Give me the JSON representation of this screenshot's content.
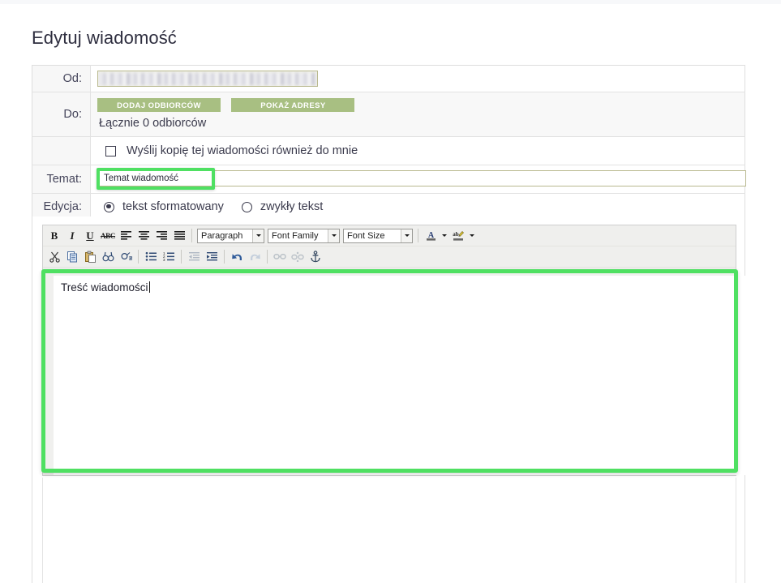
{
  "page": {
    "title": "Edytuj wiadomość"
  },
  "form": {
    "from": {
      "label": "Od:",
      "value": "",
      "redacted": true
    },
    "to": {
      "label": "Do:",
      "add_recipients_button": "DODAJ ODBIORCÓW",
      "show_addresses_button": "POKAŻ ADRESY",
      "recipients_count_text": "Łącznie 0 odbiorców"
    },
    "copy_to_me": {
      "label": "Wyślij kopię tej wiadomości również do mnie",
      "checked": false
    },
    "subject": {
      "label": "Temat:",
      "value": "Temat wiadomość",
      "placeholder": "",
      "highlighted": true
    },
    "edition": {
      "label": "Edycja:",
      "options": [
        {
          "label": "tekst sformatowany",
          "selected": true
        },
        {
          "label": "zwykły tekst",
          "selected": false
        }
      ]
    }
  },
  "editor": {
    "toolbar_row1": [
      {
        "name": "bold-icon",
        "label": "B"
      },
      {
        "name": "italic-icon",
        "label": "I"
      },
      {
        "name": "underline-icon",
        "label": "U"
      },
      {
        "name": "strikethrough-icon",
        "label": "ABC"
      },
      {
        "name": "align-left-icon",
        "label": ""
      },
      {
        "name": "align-center-icon",
        "label": ""
      },
      {
        "name": "align-right-icon",
        "label": ""
      },
      {
        "name": "align-justify-icon",
        "label": ""
      }
    ],
    "paragraph_select": "Paragraph",
    "font_family_select": "Font Family",
    "font_size_select": "Font Size",
    "text_color_icon": "A",
    "highlight_color_icon": "ab",
    "toolbar_row2": [
      {
        "name": "cut-icon"
      },
      {
        "name": "copy-icon"
      },
      {
        "name": "paste-icon"
      },
      {
        "name": "find-icon"
      },
      {
        "name": "find-replace-icon"
      },
      {
        "name": "bullet-list-icon"
      },
      {
        "name": "numbered-list-icon"
      },
      {
        "name": "outdent-icon"
      },
      {
        "name": "indent-icon"
      },
      {
        "name": "undo-icon"
      },
      {
        "name": "redo-icon"
      },
      {
        "name": "link-icon"
      },
      {
        "name": "unlink-icon"
      },
      {
        "name": "anchor-icon"
      }
    ],
    "body_text": "Treść wiadomości",
    "body_highlighted": true
  },
  "colors": {
    "highlight_green": "#4fe062",
    "button_green": "#a8bf82",
    "toolbar_bg": "#efefed",
    "label_bg": "#f7f7f7",
    "input_border": "#b9b98f"
  }
}
